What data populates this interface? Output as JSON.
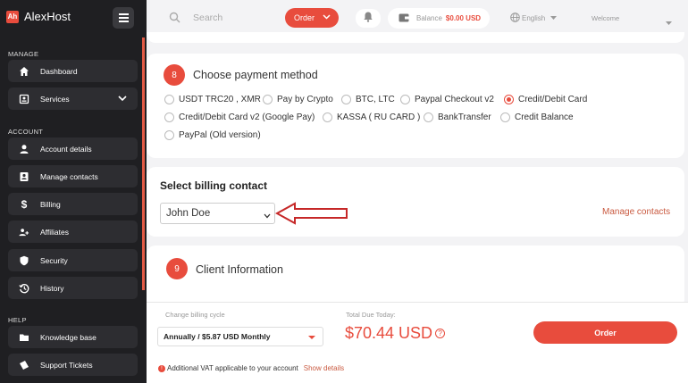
{
  "brand": {
    "logo_text": "Ah",
    "name": "AlexHost"
  },
  "sidebar": {
    "manage_label": "MANAGE",
    "account_label": "ACCOUNT",
    "help_label": "HELP",
    "items": [
      {
        "label": "Dashboard",
        "icon": "home-icon"
      },
      {
        "label": "Services",
        "icon": "services-icon"
      },
      {
        "label": "Account details",
        "icon": "person-icon"
      },
      {
        "label": "Manage contacts",
        "icon": "contacts-icon"
      },
      {
        "label": "Billing",
        "icon": "dollar-icon"
      },
      {
        "label": "Affiliates",
        "icon": "affiliates-icon"
      },
      {
        "label": "Security",
        "icon": "shield-icon"
      },
      {
        "label": "History",
        "icon": "history-icon"
      },
      {
        "label": "Knowledge base",
        "icon": "folder-icon"
      },
      {
        "label": "Support Tickets",
        "icon": "tickets-icon"
      }
    ]
  },
  "topbar": {
    "search_placeholder": "Search",
    "order_label": "Order",
    "balance_label": "Balance",
    "balance_value": "$0.00 USD",
    "language": "English",
    "welcome": "Welcome"
  },
  "payment": {
    "step": "8",
    "title": "Choose payment method",
    "options": [
      "USDT TRC20 , XMR",
      "Pay by Crypto",
      "BTC, LTC",
      "Paypal Checkout v2",
      "Credit/Debit Card",
      "Credit/Debit Card v2 (Google Pay)",
      "KASSA ( RU CARD )",
      "BankTransfer",
      "Credit Balance",
      "PayPal (Old version)"
    ],
    "selected": "Credit/Debit Card"
  },
  "billing": {
    "title": "Select billing contact",
    "contact": "John Doe",
    "manage_link": "Manage contacts"
  },
  "client": {
    "step": "9",
    "title": "Client Information"
  },
  "footer": {
    "cycle_label": "Change billing cycle",
    "cycle_value": "Annually / $5.87 USD Monthly",
    "total_label": "Total Due Today:",
    "total_value": "$70.44 USD",
    "order_button": "Order",
    "vat_text": "Additional VAT applicable to your account",
    "vat_link": "Show details"
  },
  "colors": {
    "accent": "#e84c3d",
    "sidebar_bg": "#1f1f22",
    "nav_item_bg": "#2d2d31"
  }
}
